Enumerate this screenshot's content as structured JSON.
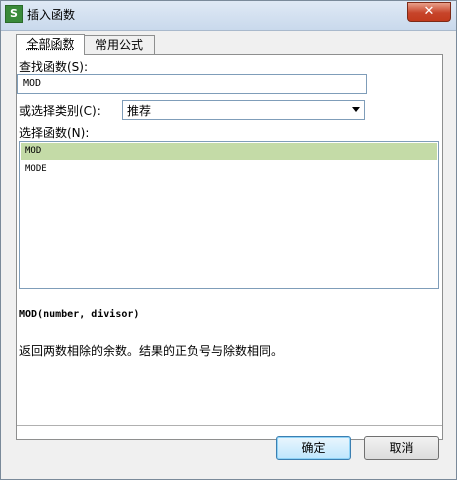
{
  "window": {
    "title": "插入函数",
    "app_icon_glyph": "S",
    "close_glyph": "✕"
  },
  "tabs": [
    {
      "label": "全部函数",
      "active": true
    },
    {
      "label": "常用公式",
      "active": false
    }
  ],
  "search": {
    "label": "查找函数(S):",
    "value": "MOD"
  },
  "category": {
    "label": "或选择类别(C):",
    "selected": "推荐"
  },
  "functions": {
    "label": "选择函数(N):",
    "items": [
      {
        "name": "MOD",
        "selected": true
      },
      {
        "name": "MODE",
        "selected": false
      }
    ]
  },
  "detail": {
    "signature": "MOD(number, divisor)",
    "description": "返回两数相除的余数。结果的正负号与除数相同。"
  },
  "buttons": {
    "ok": "确定",
    "cancel": "取消"
  },
  "colors": {
    "selected_row": "#c4dba7",
    "ok_button": "#bee6fd",
    "close_button": "#c7442a"
  }
}
